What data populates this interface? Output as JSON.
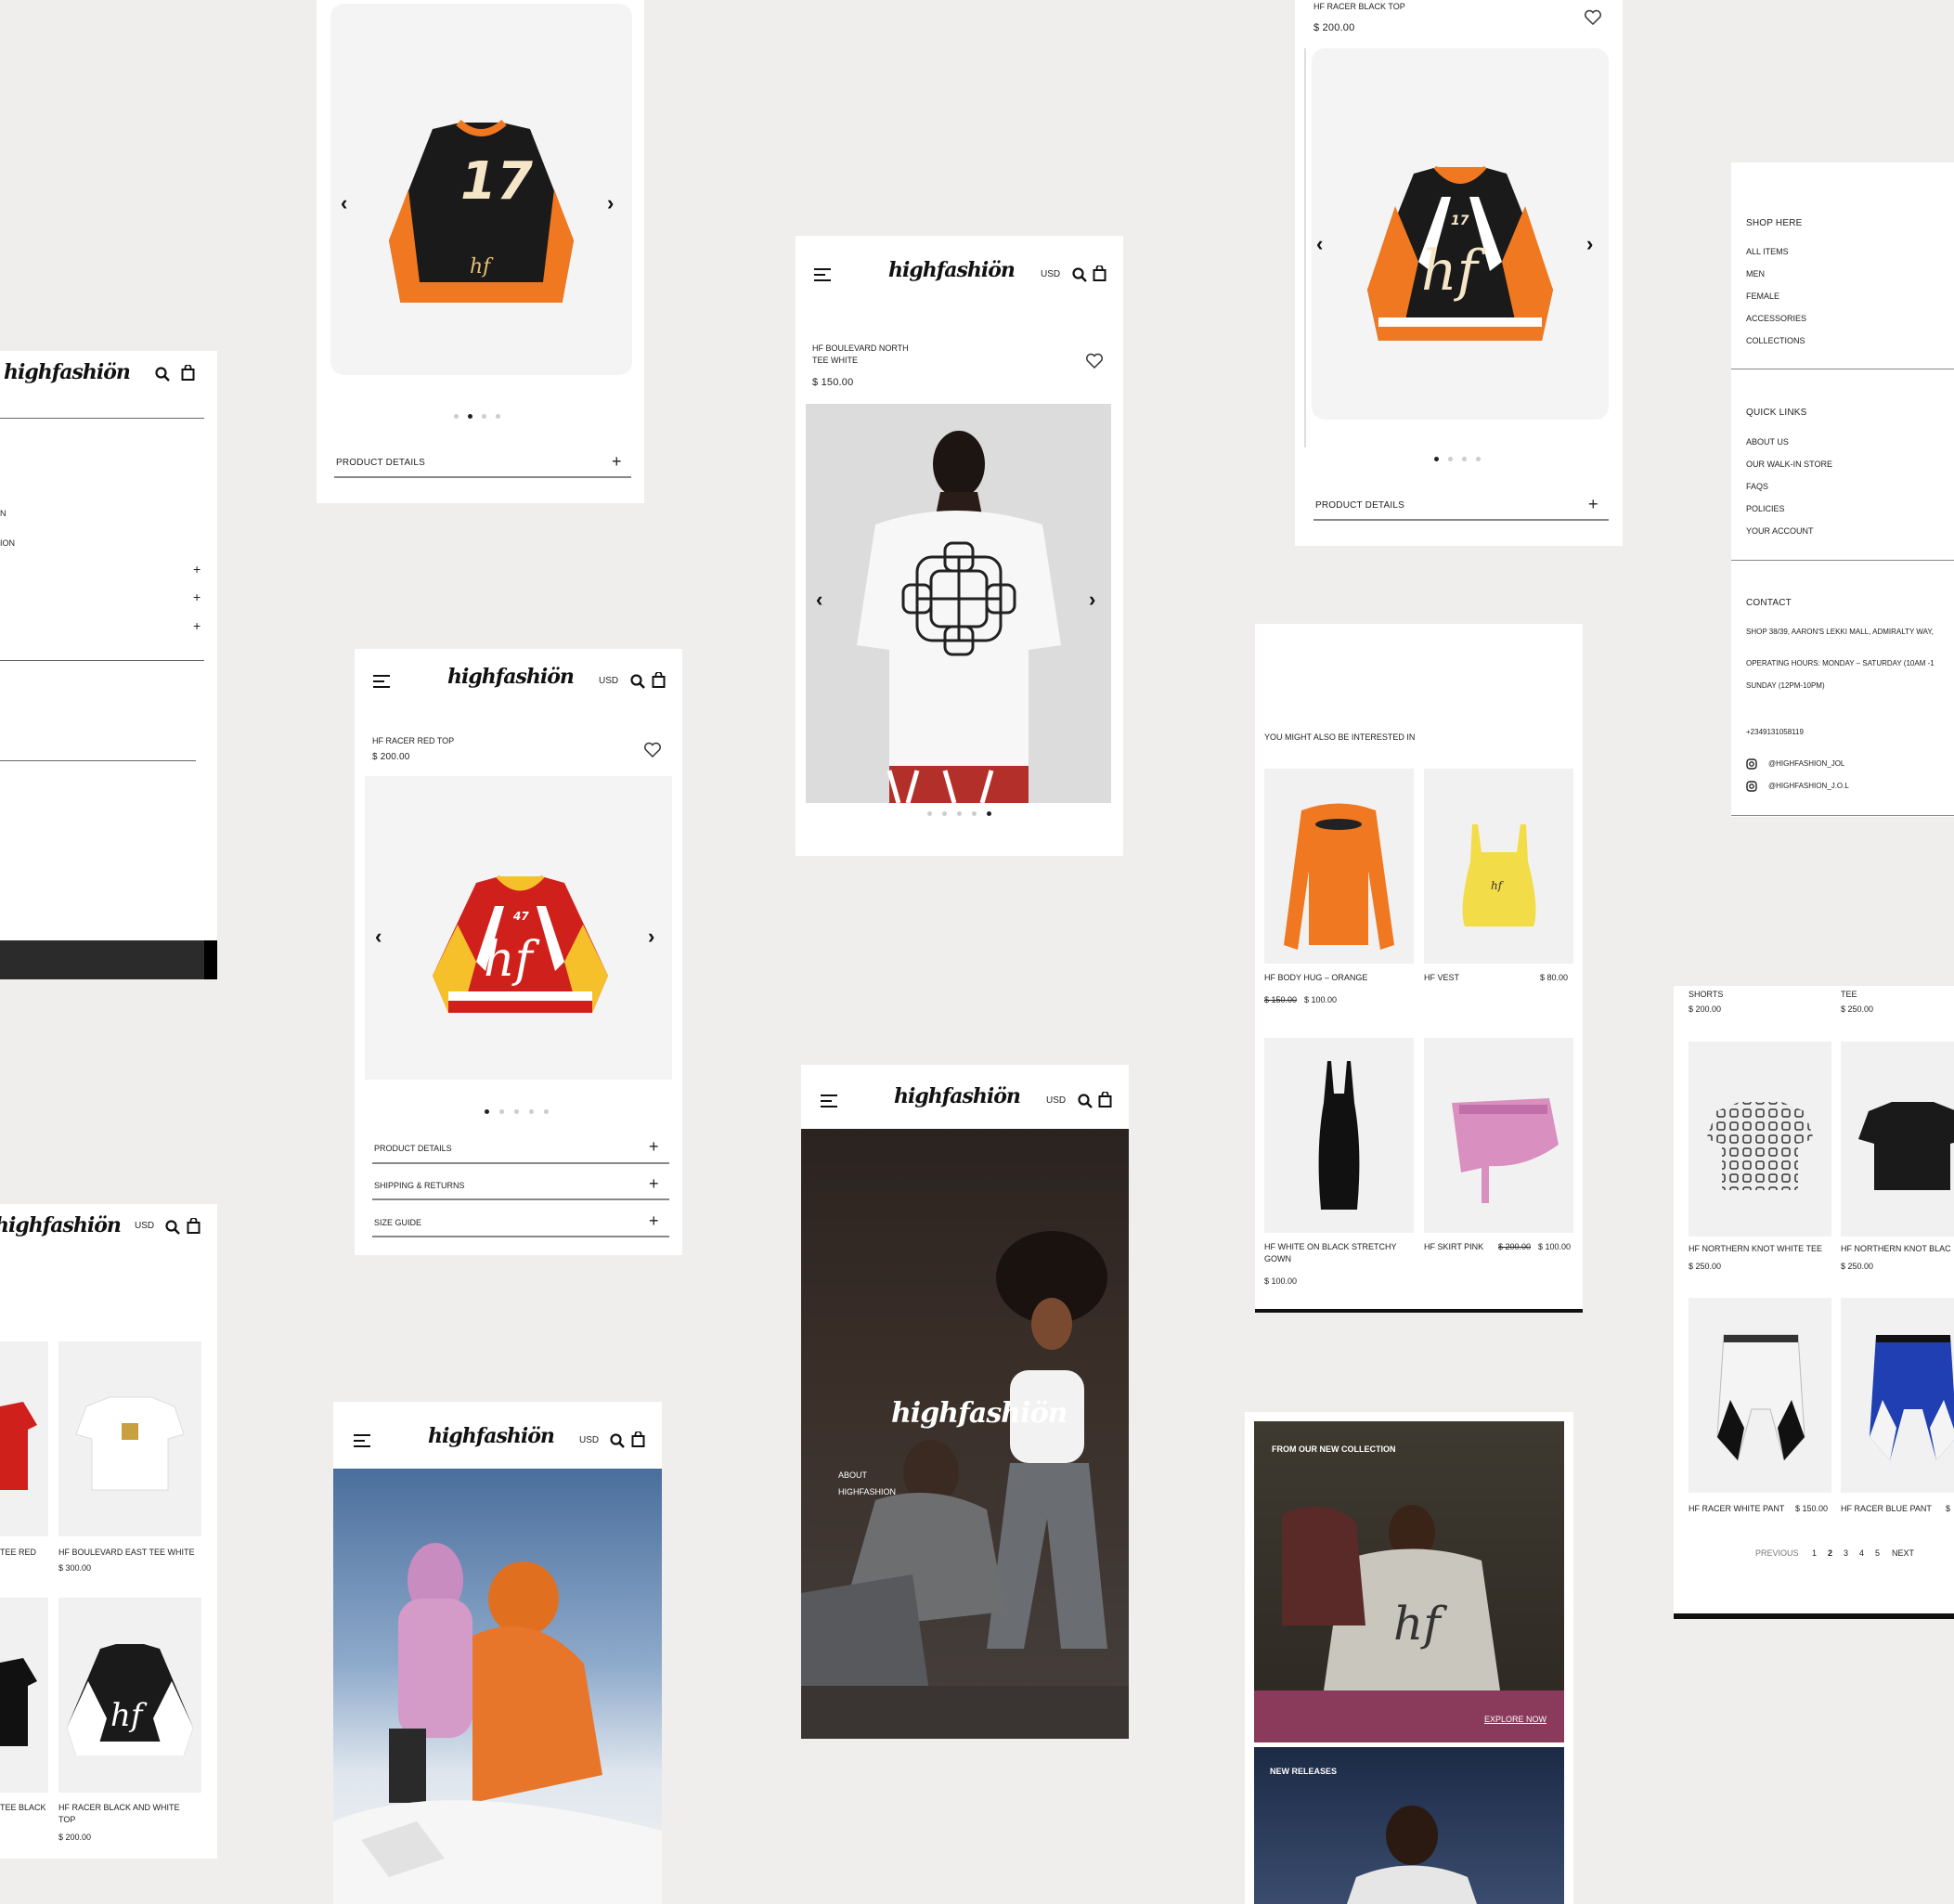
{
  "brand": {
    "logo": "highfashiön",
    "currency": "USD"
  },
  "card_orange_jersey": {
    "product_details": "PRODUCT DETAILS"
  },
  "card_boulevard": {
    "name_line1": "HF BOULEVARD NORTH",
    "name_line2": "TEE WHITE",
    "price": "$ 150.00"
  },
  "card_black_top": {
    "name": "HF RACER BLACK TOP",
    "price": "$ 200.00",
    "product_details": "PRODUCT DETAILS"
  },
  "card_red_top": {
    "name": "HF RACER RED TOP",
    "price": "$ 200.00",
    "accordion": [
      "PRODUCT DETAILS",
      "SHIPPING & RETURNS",
      "SIZE GUIDE"
    ]
  },
  "card_left_menu": {
    "fragments": [
      "N",
      "ION"
    ]
  },
  "footer_menu": {
    "shop_heading": "SHOP HERE",
    "shop_links": [
      "ALL ITEMS",
      "MEN",
      "FEMALE",
      "ACCESSORIES",
      "COLLECTIONS"
    ],
    "quick_heading": "QUICK LINKS",
    "quick_links": [
      "ABOUT US",
      "OUR WALK-IN STORE",
      "FAQS",
      "POLICIES",
      "YOUR ACCOUNT"
    ],
    "contact_heading": "CONTACT",
    "address": "SHOP 38/39, AARON'S LEKKI MALL, ADMIRALTY WAY,",
    "hours1": "OPERATING HOURS: MONDAY – SATURDAY (10AM -1",
    "hours2": "SUNDAY (12PM-10PM)",
    "phone": "+2349131058119",
    "instagram1": "@HIGHFASHION_JOL",
    "instagram2": "@HIGHFASHION_J.O.L"
  },
  "related": {
    "heading": "YOU MIGHT ALSO BE INTERESTED IN",
    "items": [
      {
        "name": "HF BODY HUG – ORANGE",
        "old_price": "$ 150.00",
        "price": "$ 100.00"
      },
      {
        "name": "HF VEST",
        "price": "$ 80.00"
      },
      {
        "name": "HF WHITE ON BLACK STRETCHY",
        "name2": "GOWN",
        "price": "$ 100.00"
      },
      {
        "name": "HF SKIRT PINK",
        "old_price": "$ 200.00",
        "price": "$ 100.00"
      }
    ]
  },
  "grid_right": {
    "top": [
      {
        "name": "SHORTS",
        "price": "$ 200.00"
      },
      {
        "name": "TEE",
        "price": "$ 250.00"
      }
    ],
    "items": [
      {
        "name": "HF NORTHERN KNOT WHITE TEE",
        "price": "$ 250.00"
      },
      {
        "name": "HF NORTHERN KNOT BLAC",
        "price": "$ 250.00"
      },
      {
        "name": "HF RACER WHITE PANT",
        "price": "$ 150.00"
      },
      {
        "name": "HF RACER BLUE PANT",
        "price": "$"
      }
    ],
    "pagination": {
      "previous": "PREVIOUS",
      "pages": [
        "1",
        "2",
        "3",
        "4",
        "5"
      ],
      "next": "NEXT"
    }
  },
  "grid_left": {
    "items": [
      {
        "name": "TEE RED"
      },
      {
        "name": "HF BOULEVARD EAST TEE WHITE",
        "price": "$ 300.00"
      },
      {
        "name": "TEE BLACK"
      },
      {
        "name": "HF RACER BLACK AND WHITE",
        "name2": "TOP",
        "price": "$ 200.00"
      }
    ]
  },
  "hero": {
    "about_line1": "ABOUT",
    "about_line2": "HIGHFASHION"
  },
  "collection": {
    "label": "FROM OUR NEW COLLECTION",
    "cta": "EXPLORE NOW",
    "new_releases": "NEW RELEASES"
  },
  "colors": {
    "bg": "#efeeec",
    "black": "#111111",
    "jersey_orange": "#f07820",
    "jersey_red": "#d0201c",
    "jersey_yellow": "#f5c02a"
  }
}
